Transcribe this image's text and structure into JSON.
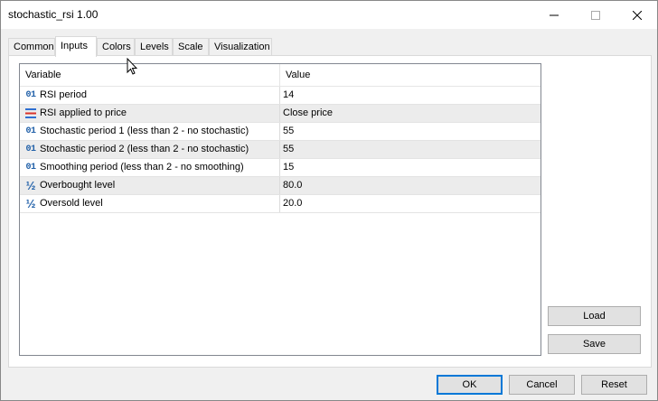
{
  "window": {
    "title": "stochastic_rsi 1.00"
  },
  "tabs": [
    {
      "label": "Common"
    },
    {
      "label": "Inputs"
    },
    {
      "label": "Colors"
    },
    {
      "label": "Levels"
    },
    {
      "label": "Scale"
    },
    {
      "label": "Visualization"
    }
  ],
  "active_tab": "Inputs",
  "grid": {
    "headers": {
      "variable": "Variable",
      "value": "Value"
    },
    "rows": [
      {
        "icon": "integer-icon",
        "icon_text": "01",
        "variable": "RSI period",
        "value": "14"
      },
      {
        "icon": "enum-list-icon",
        "variable": "RSI applied to price",
        "value": "Close price"
      },
      {
        "icon": "integer-icon",
        "icon_text": "01",
        "variable": "Stochastic period 1 (less than 2 - no stochastic)",
        "value": "55"
      },
      {
        "icon": "integer-icon",
        "icon_text": "01",
        "variable": "Stochastic period 2 (less than 2 - no stochastic)",
        "value": "55"
      },
      {
        "icon": "integer-icon",
        "icon_text": "01",
        "variable": "Smoothing period (less than 2 - no smoothing)",
        "value": "15"
      },
      {
        "icon": "fraction-icon",
        "icon_text": "½",
        "variable": "Overbought level",
        "value": "80.0"
      },
      {
        "icon": "fraction-icon",
        "icon_text": "½",
        "variable": "Oversold level",
        "value": "20.0"
      }
    ]
  },
  "side_buttons": {
    "load": "Load",
    "save": "Save"
  },
  "footer_buttons": {
    "ok": "OK",
    "cancel": "Cancel",
    "reset": "Reset"
  },
  "colors": {
    "icon_blue": "#1f5fa8",
    "enum_icon_red": "#d9342b",
    "enum_icon_blue": "#2f6fd1",
    "default_button_border": "#0078d7",
    "alt_row": "#ececec"
  }
}
